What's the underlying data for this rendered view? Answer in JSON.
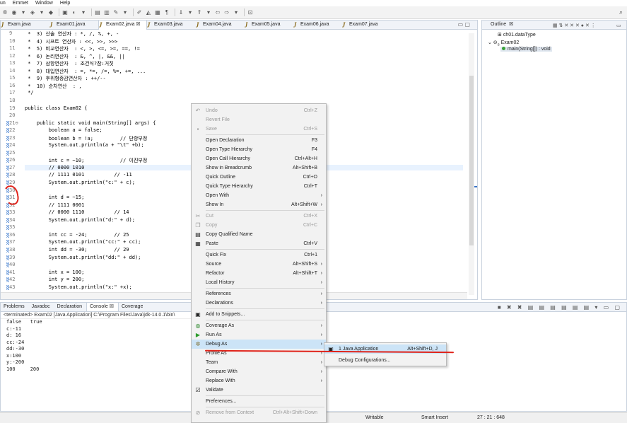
{
  "menubar": {
    "items": [
      "un",
      "Emmet",
      "Window",
      "Help"
    ]
  },
  "editor": {
    "tabs": [
      "Exam.java",
      "Exam01.java",
      "Exam02.java",
      "Exam03.java",
      "Exam04.java",
      "Exam05.java",
      "Exam06.java",
      "Exam07.java"
    ],
    "active_tab": "Exam02.java",
    "active_close": "☒",
    "lines": [
      {
        "n": "9",
        "t": " *  3) 산술 연산자 : *, /, %, +, -"
      },
      {
        "n": "10",
        "t": " *  4) 시프트 연산자 : <<, >>, >>>"
      },
      {
        "n": "11",
        "t": " *  5) 비교연산자  : <, >, <=, >=, ==, !="
      },
      {
        "n": "12",
        "t": " *  6) 논리연산자  : &, ^, |, &&, ||"
      },
      {
        "n": "13",
        "t": " *  7) 삼항연산자  : 조건식?참:거짓"
      },
      {
        "n": "14",
        "t": " *  8) 대입연산자  : =, *=, /=, %=, +=, ..."
      },
      {
        "n": "15",
        "t": " *  9) 후위형증감연산자 : ++/--"
      },
      {
        "n": "16",
        "t": " *  10) 순차연산  : ,"
      },
      {
        "n": "17",
        "t": " */"
      },
      {
        "n": "18",
        "t": ""
      },
      {
        "n": "19",
        "t": "public class Exam02 {"
      },
      {
        "n": "20",
        "t": ""
      },
      {
        "n": "21⊖",
        "t": "    public static void main(String[] args) {"
      },
      {
        "n": "22",
        "t": "        boolean a = false;"
      },
      {
        "n": "23",
        "t": "        boolean b = !a;         // 단항부정"
      },
      {
        "n": "24",
        "t": "        System.out.println(a + \"\\t\" +b);"
      },
      {
        "n": "25",
        "t": ""
      },
      {
        "n": "26",
        "t": "        int c = ~10;            // 이진부정"
      },
      {
        "n": "27",
        "t": "        // 0000 1010"
      },
      {
        "n": "28",
        "t": "        // 1111 0101          // -11"
      },
      {
        "n": "29",
        "t": "        System.out.println(\"c:\" + c);"
      },
      {
        "n": "30",
        "t": ""
      },
      {
        "n": "31",
        "t": "        int d = ~15;"
      },
      {
        "n": "32",
        "t": "        // 1111 0001"
      },
      {
        "n": "33",
        "t": "        // 0000 1110          // 14"
      },
      {
        "n": "34",
        "t": "        System.out.println(\"d:\" + d);"
      },
      {
        "n": "35",
        "t": ""
      },
      {
        "n": "36",
        "t": "        int cc = -24;         // 25"
      },
      {
        "n": "37",
        "t": "        System.out.println(\"cc:\" + cc);"
      },
      {
        "n": "38",
        "t": "        int dd = -30;         // 29"
      },
      {
        "n": "39",
        "t": "        System.out.println(\"dd:\" + dd);"
      },
      {
        "n": "40",
        "t": ""
      },
      {
        "n": "41",
        "t": "        int x = 100;"
      },
      {
        "n": "42",
        "t": "        int y = 200;"
      },
      {
        "n": "43",
        "t": "        System.out.println(\"x:\" +x);"
      }
    ]
  },
  "outline": {
    "title": "Outline",
    "close": "☒",
    "items": [
      "ch01.dataType",
      "Exam02",
      "main(String[]) : void"
    ]
  },
  "console": {
    "tabs": [
      "Problems",
      "Javadoc",
      "Declaration",
      "Console ☒",
      "Coverage"
    ],
    "terminated": "<terminated> Exam02 [Java Application] C:\\Program Files\\Java\\jdk-14.0.1\\bin\\",
    "output": [
      "false   true",
      "c:-11",
      "d: 16",
      "cc:-24",
      "dd:-30",
      "x:100",
      "y:-200",
      "100     200"
    ]
  },
  "statusbar": {
    "writable": "Writable",
    "mode": "Smart Insert",
    "position": "27 : 21 : 648"
  },
  "context_menu": {
    "items": [
      {
        "label": "Undo",
        "shortcut": "Ctrl+Z",
        "disabled": true,
        "icon": "undo-icon"
      },
      {
        "label": "Revert File",
        "shortcut": "",
        "disabled": true
      },
      {
        "label": "Save",
        "shortcut": "Ctrl+S",
        "disabled": true,
        "icon": "save-icon"
      },
      {
        "sep": true
      },
      {
        "label": "Open Declaration",
        "shortcut": "F3"
      },
      {
        "label": "Open Type Hierarchy",
        "shortcut": "F4"
      },
      {
        "label": "Open Call Hierarchy",
        "shortcut": "Ctrl+Alt+H"
      },
      {
        "label": "Show in Breadcrumb",
        "shortcut": "Alt+Shift+B"
      },
      {
        "label": "Quick Outline",
        "shortcut": "Ctrl+O"
      },
      {
        "label": "Quick Type Hierarchy",
        "shortcut": "Ctrl+T"
      },
      {
        "label": "Open With",
        "submenu": true
      },
      {
        "label": "Show In",
        "shortcut": "Alt+Shift+W",
        "submenu": true
      },
      {
        "sep": true
      },
      {
        "label": "Cut",
        "shortcut": "Ctrl+X",
        "disabled": true,
        "icon": "cut-icon"
      },
      {
        "label": "Copy",
        "shortcut": "Ctrl+C",
        "disabled": true,
        "icon": "copy-icon"
      },
      {
        "label": "Copy Qualified Name",
        "shortcut": "",
        "icon": "copy-qualified-icon"
      },
      {
        "label": "Paste",
        "shortcut": "Ctrl+V",
        "icon": "paste-icon"
      },
      {
        "sep": true
      },
      {
        "label": "Quick Fix",
        "shortcut": "Ctrl+1"
      },
      {
        "label": "Source",
        "shortcut": "Alt+Shift+S",
        "submenu": true
      },
      {
        "label": "Refactor",
        "shortcut": "Alt+Shift+T",
        "submenu": true
      },
      {
        "label": "Local History",
        "submenu": true
      },
      {
        "sep": true
      },
      {
        "label": "References",
        "submenu": true
      },
      {
        "label": "Declarations",
        "submenu": true
      },
      {
        "sep": true
      },
      {
        "label": "Add to Snippets...",
        "icon": "snippet-icon"
      },
      {
        "sep": true
      },
      {
        "label": "Coverage As",
        "submenu": true,
        "icon": "coverage-icon"
      },
      {
        "label": "Run As",
        "submenu": true,
        "icon": "run-icon"
      },
      {
        "label": "Debug As",
        "submenu": true,
        "hot": true,
        "icon": "debug-icon"
      },
      {
        "label": "Profile As",
        "submenu": true
      },
      {
        "label": "Team",
        "submenu": true
      },
      {
        "label": "Compare With",
        "submenu": true
      },
      {
        "label": "Replace With",
        "submenu": true
      },
      {
        "label": "Validate",
        "icon": "check-icon"
      },
      {
        "sep": true
      },
      {
        "label": "Preferences..."
      },
      {
        "sep": true
      },
      {
        "label": "Remove from Context",
        "shortcut": "Ctrl+Alt+Shift+Down",
        "disabled": true,
        "icon": "remove-context-icon"
      }
    ]
  },
  "submenu": {
    "items": [
      {
        "label": "1 Java Application",
        "shortcut": "Alt+Shift+D, J"
      },
      {
        "label": "Debug Configurations..."
      }
    ]
  },
  "colors": {
    "annotation_red": "#e0231a",
    "hover": "#cce4f7"
  }
}
